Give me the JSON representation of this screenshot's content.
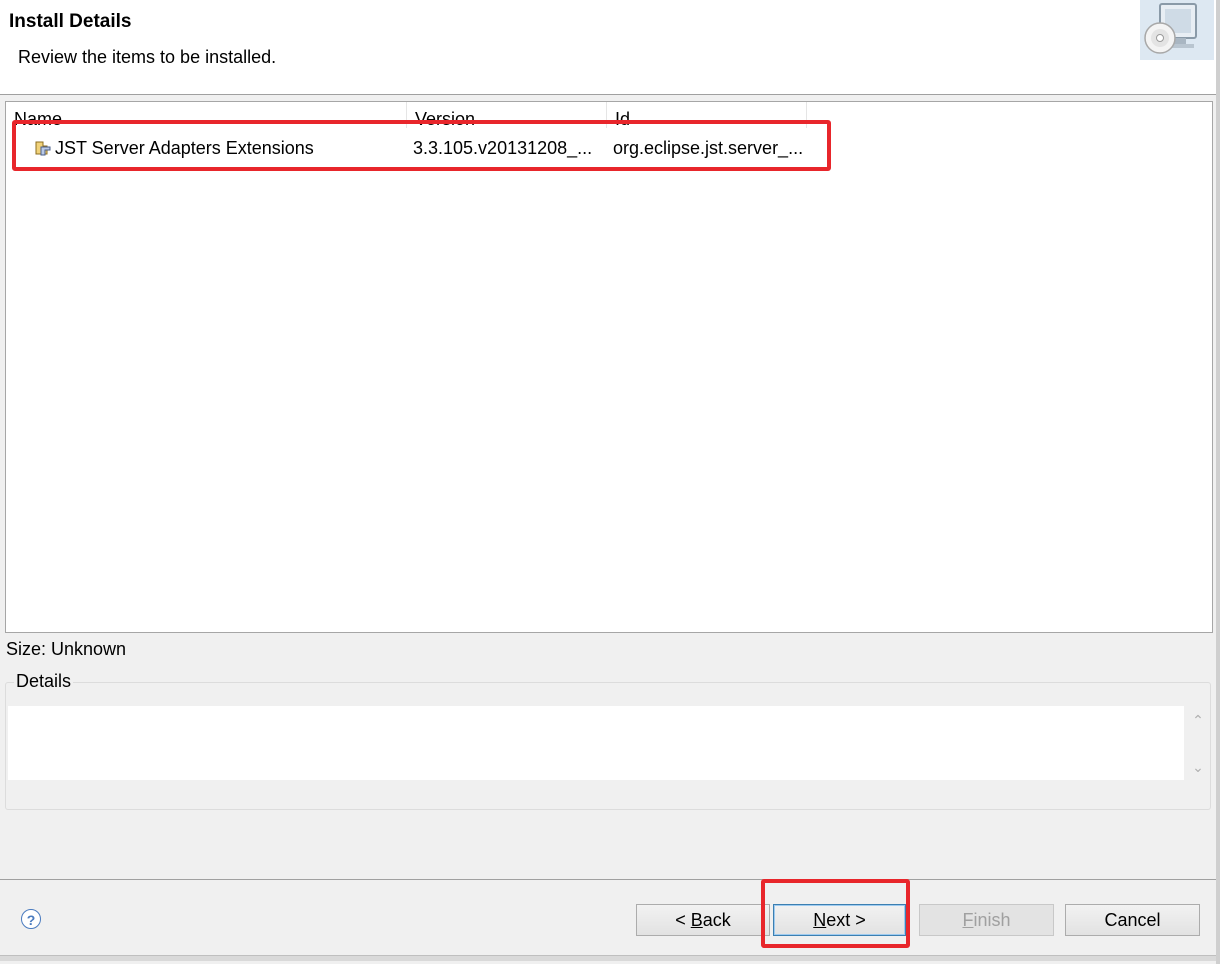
{
  "header": {
    "title": "Install Details",
    "description": "Review the items to be installed."
  },
  "table": {
    "columns": [
      "Name",
      "Version",
      "Id"
    ],
    "rows": [
      {
        "name": "JST Server Adapters Extensions",
        "version": "3.3.105.v20131208_...",
        "id": "org.eclipse.jst.server_..."
      }
    ]
  },
  "size": {
    "label": "Size: Unknown"
  },
  "details": {
    "legend": "Details",
    "text": ""
  },
  "buttons": {
    "back_pre": "< ",
    "back_mnemonic": "B",
    "back_post": "ack",
    "next_mnemonic": "N",
    "next_post": "ext >",
    "finish_mnemonic": "F",
    "finish_post": "inish",
    "cancel": "Cancel"
  },
  "icons": {
    "banner": "install-cd-computer-icon",
    "row": "feature-plugin-icon",
    "help": "help-icon"
  },
  "highlight_color": "#e8262b"
}
